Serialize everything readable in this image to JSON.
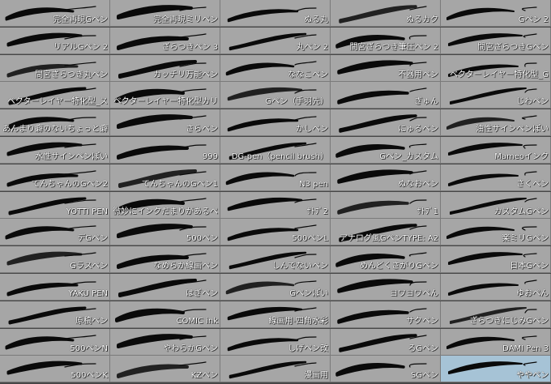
{
  "brushes": [
    {
      "label": "完全再現Gペン",
      "icon": "brush-stroke-icon"
    },
    {
      "label": "完全再現ミリペン",
      "icon": "brush-stroke-icon"
    },
    {
      "label": "ぬる丸",
      "icon": "brush-stroke-icon"
    },
    {
      "label": "ぬるカク",
      "icon": "brush-stroke-icon"
    },
    {
      "label": "Gペン 2",
      "icon": "brush-stroke-icon"
    },
    {
      "label": "リアルGペン 2",
      "icon": "brush-stroke-icon"
    },
    {
      "label": "ざらつきペン 3",
      "icon": "brush-stroke-icon"
    },
    {
      "label": "丸ペン 2",
      "icon": "brush-stroke-icon"
    },
    {
      "label": "間宮ざらつき筆圧ペン 2",
      "icon": "brush-stroke-icon"
    },
    {
      "label": "間宮ざらつきGペン",
      "icon": "brush-stroke-icon"
    },
    {
      "label": "間宮ざらつき丸ペン",
      "icon": "brush-stroke-icon"
    },
    {
      "label": "カッチリ万能ペン",
      "icon": "brush-stroke-icon"
    },
    {
      "label": "ななこペン",
      "icon": "brush-stroke-icon"
    },
    {
      "label": "不器用ペン",
      "icon": "brush-stroke-icon"
    },
    {
      "label": "ベクターレイヤー特化型_G",
      "icon": "brush-stroke-icon"
    },
    {
      "label": "ベクターレイヤー特化型_ス",
      "icon": "brush-stroke-icon"
    },
    {
      "label": "ベクターレイヤー特化型カリ",
      "icon": "brush-stroke-icon"
    },
    {
      "label": "Gペン（手羽先）",
      "icon": "brush-stroke-icon"
    },
    {
      "label": "ぎゅん",
      "icon": "brush-stroke-icon"
    },
    {
      "label": "じわペン",
      "icon": "brush-stroke-icon"
    },
    {
      "label": "あんまり癖のないちょっと癖",
      "icon": "brush-stroke-icon"
    },
    {
      "label": "さらペン",
      "icon": "brush-stroke-icon"
    },
    {
      "label": "かしペン",
      "icon": "brush-stroke-icon"
    },
    {
      "label": "にゅるペン",
      "icon": "brush-stroke-icon"
    },
    {
      "label": "油性サインペンぽい",
      "icon": "brush-stroke-icon"
    },
    {
      "label": "水性サインペンぽい",
      "icon": "brush-stroke-icon"
    },
    {
      "label": "999",
      "icon": "brush-stroke-icon"
    },
    {
      "label": "DG-pen（pencil brush）",
      "icon": "brush-stroke-icon"
    },
    {
      "label": "Gペン_カスタム",
      "icon": "brush-stroke-icon"
    },
    {
      "label": "Mameoインク",
      "icon": "brush-stroke-icon"
    },
    {
      "label": "てんちゃんのGペン2",
      "icon": "brush-stroke-icon"
    },
    {
      "label": "てんちゃんのGペン1",
      "icon": "brush-stroke-icon"
    },
    {
      "label": "N3 pen",
      "icon": "brush-stroke-icon"
    },
    {
      "label": "ぬなおペン",
      "icon": "brush-stroke-icon"
    },
    {
      "label": "さくペン",
      "icon": "brush-stroke-icon"
    },
    {
      "label": "YOTTI PEN",
      "icon": "brush-stroke-icon"
    },
    {
      "label": "微妙にインクだまりがあるペ",
      "icon": "brush-stroke-icon"
    },
    {
      "label": "ｻﾄﾌﾟ2",
      "icon": "brush-stroke-icon"
    },
    {
      "label": "ｻﾄﾌﾟ1",
      "icon": "brush-stroke-icon"
    },
    {
      "label": "カスタムGペン",
      "icon": "brush-stroke-icon"
    },
    {
      "label": "デGペン",
      "icon": "brush-stroke-icon"
    },
    {
      "label": "500ペン",
      "icon": "brush-stroke-icon"
    },
    {
      "label": "500ペンL",
      "icon": "brush-stroke-icon"
    },
    {
      "label": "アナログ風GペンTYPE: A2",
      "icon": "brush-stroke-icon"
    },
    {
      "label": "楽ミリGペン",
      "icon": "brush-stroke-icon"
    },
    {
      "label": "Gラスペン",
      "icon": "brush-stroke-icon"
    },
    {
      "label": "なめらか線画ペン",
      "icon": "brush-stroke-icon"
    },
    {
      "label": "しんでないペン",
      "icon": "brush-stroke-icon"
    },
    {
      "label": "めんどくさがりGペン",
      "icon": "brush-stroke-icon"
    },
    {
      "label": "日本Gペン",
      "icon": "brush-stroke-icon"
    },
    {
      "label": "YAKU PEN",
      "icon": "brush-stroke-icon"
    },
    {
      "label": "はぎペン",
      "icon": "brush-stroke-icon"
    },
    {
      "label": "Gペンぽい",
      "icon": "brush-stroke-icon"
    },
    {
      "label": "ヨワヨワペん",
      "icon": "brush-stroke-icon"
    },
    {
      "label": "ゆおぺん",
      "icon": "brush-stroke-icon"
    },
    {
      "label": "原稿ペン",
      "icon": "brush-stroke-icon"
    },
    {
      "label": "COMIC ink",
      "icon": "brush-stroke-icon"
    },
    {
      "label": "線画用-四角水彩",
      "icon": "brush-stroke-icon"
    },
    {
      "label": "サクペン",
      "icon": "brush-stroke-icon"
    },
    {
      "label": "ざらつきにじみGペン",
      "icon": "brush-stroke-icon"
    },
    {
      "label": "500ペンN",
      "icon": "brush-stroke-icon"
    },
    {
      "label": "やわらかGペン",
      "icon": "brush-stroke-icon"
    },
    {
      "label": "しげペン改",
      "icon": "brush-stroke-icon"
    },
    {
      "label": "ろGペン",
      "icon": "brush-stroke-icon"
    },
    {
      "label": "DAMI Pen 3",
      "icon": "brush-stroke-icon"
    },
    {
      "label": "500ペンK",
      "icon": "brush-stroke-icon"
    },
    {
      "label": "KZペン",
      "icon": "brush-stroke-icon"
    },
    {
      "label": "漫画用",
      "icon": "brush-stroke-icon"
    },
    {
      "label": "SGペン",
      "icon": "brush-stroke-icon"
    },
    {
      "label": "ややペン",
      "icon": "brush-stroke-icon",
      "selected": true
    }
  ],
  "colors": {
    "cell_bg": "#a6a6a6",
    "selected_bg": "#a6c3d6",
    "stroke": "#0a0a0a",
    "label": "#ffffff"
  }
}
